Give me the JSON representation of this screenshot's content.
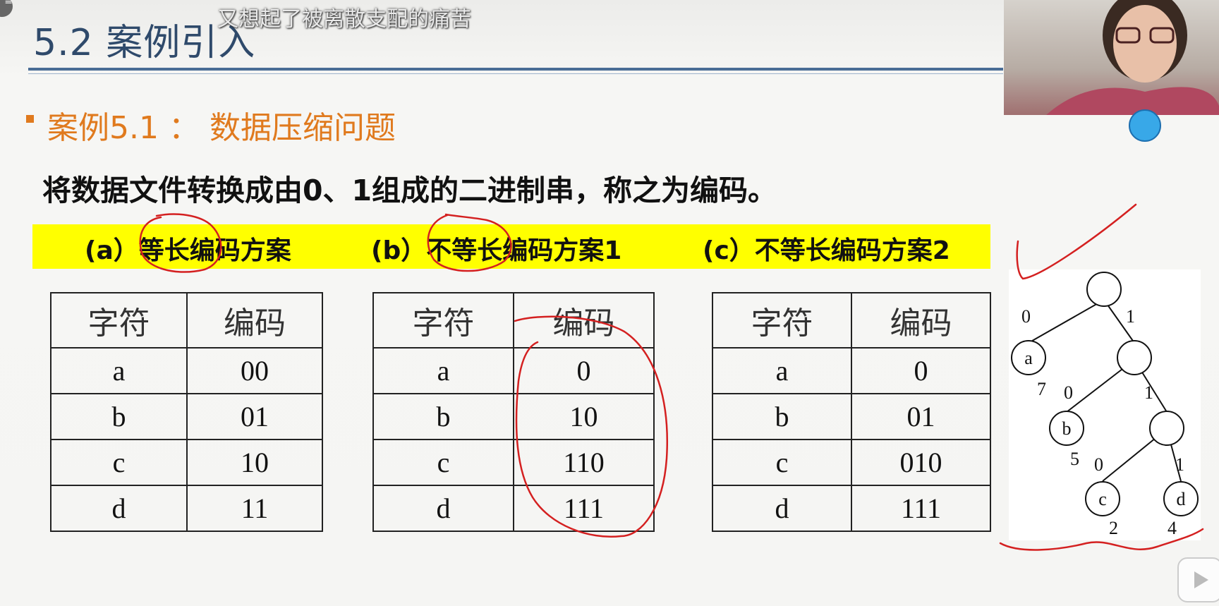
{
  "overlay_subtitle": "又想起了被离散支配的痛苦",
  "slide": {
    "title": "5.2 案例引入",
    "case_title": "案例5.1 ： 数据压缩问题",
    "statement": "将数据文件转换成由0、1组成的二进制串，称之为编码。",
    "schemes": [
      {
        "label": "(a）等长编码方案"
      },
      {
        "label": "(b）不等长编码方案1"
      },
      {
        "label": "(c）不等长编码方案2"
      }
    ],
    "table_headers": {
      "char": "字符",
      "code": "编码"
    },
    "tables": [
      {
        "rows": [
          [
            "a",
            "00"
          ],
          [
            "b",
            "01"
          ],
          [
            "c",
            "10"
          ],
          [
            "d",
            "11"
          ]
        ]
      },
      {
        "rows": [
          [
            "a",
            "0"
          ],
          [
            "b",
            "10"
          ],
          [
            "c",
            "110"
          ],
          [
            "d",
            "111"
          ]
        ]
      },
      {
        "rows": [
          [
            "a",
            "0"
          ],
          [
            "b",
            "01"
          ],
          [
            "c",
            "010"
          ],
          [
            "d",
            "111"
          ]
        ]
      }
    ]
  },
  "tree": {
    "nodes": {
      "a": "a",
      "b": "b",
      "c": "c",
      "d": "d"
    },
    "edge_labels": {
      "root_left": "0",
      "root_right": "1",
      "n1_left": "0",
      "n1_right": "1",
      "n2_left": "0",
      "n2_right": "1"
    },
    "weights": {
      "a": "7",
      "b": "5",
      "c": "2",
      "d": "4"
    }
  },
  "colors": {
    "title": "#2f4a6b",
    "accent": "#e07a1e",
    "banner": "#ffff00",
    "annotation": "#d42020"
  }
}
